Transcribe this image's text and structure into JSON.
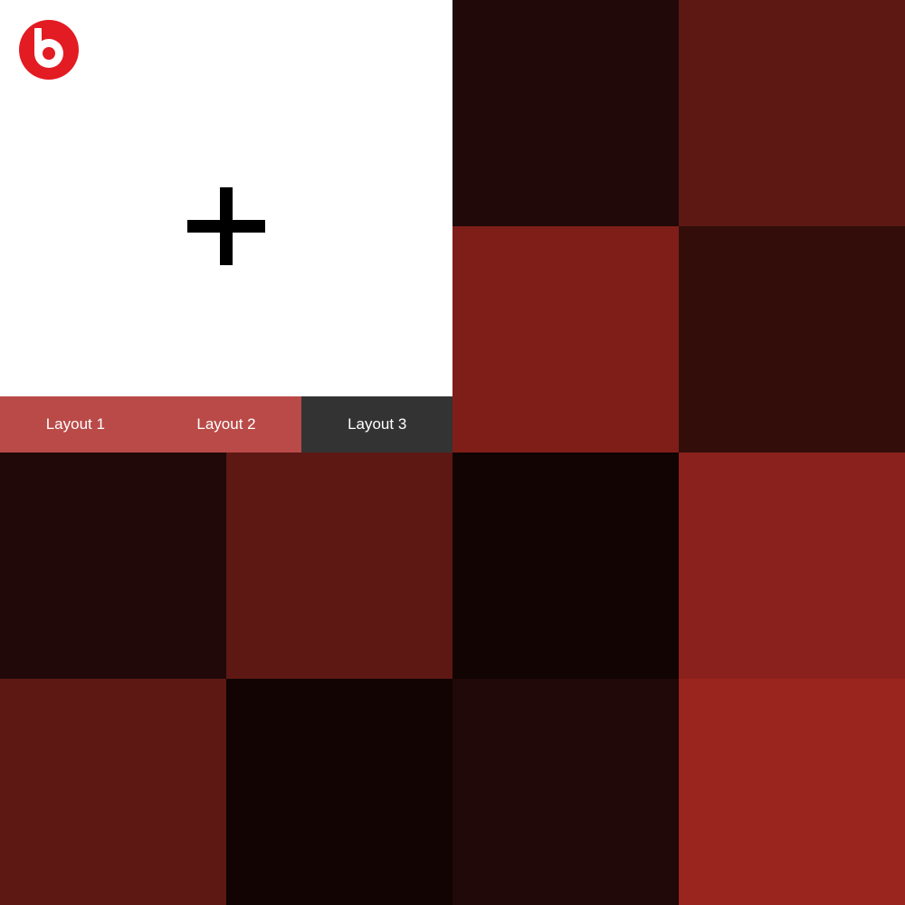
{
  "logo": {
    "icon": "beats-logo-icon",
    "color": "#e31b23"
  },
  "add_button": {
    "icon": "plus-icon",
    "color": "#000000"
  },
  "tabs": [
    {
      "label": "Layout 1",
      "background": "#b94a48",
      "active": false
    },
    {
      "label": "Layout 2",
      "background": "#b94a48",
      "active": false
    },
    {
      "label": "Layout 3",
      "background": "#333333",
      "active": true
    }
  ],
  "tiles": [
    {
      "name": "tile-r1-c3",
      "color": "#200908"
    },
    {
      "name": "tile-r1-c4",
      "color": "#5d1814"
    },
    {
      "name": "tile-r2-c3",
      "color": "#7f1e19"
    },
    {
      "name": "tile-r2-c4",
      "color": "#320d0a"
    },
    {
      "name": "tile-r3-c1",
      "color": "#200908"
    },
    {
      "name": "tile-r3-c2",
      "color": "#5d1814"
    },
    {
      "name": "tile-r3-c3",
      "color": "#110403"
    },
    {
      "name": "tile-r3-c4",
      "color": "#8b211c"
    },
    {
      "name": "tile-r4-c1",
      "color": "#5d1814"
    },
    {
      "name": "tile-r4-c2",
      "color": "#110403"
    },
    {
      "name": "tile-r4-c3",
      "color": "#200908"
    },
    {
      "name": "tile-r4-c4",
      "color": "#9a241e"
    }
  ]
}
